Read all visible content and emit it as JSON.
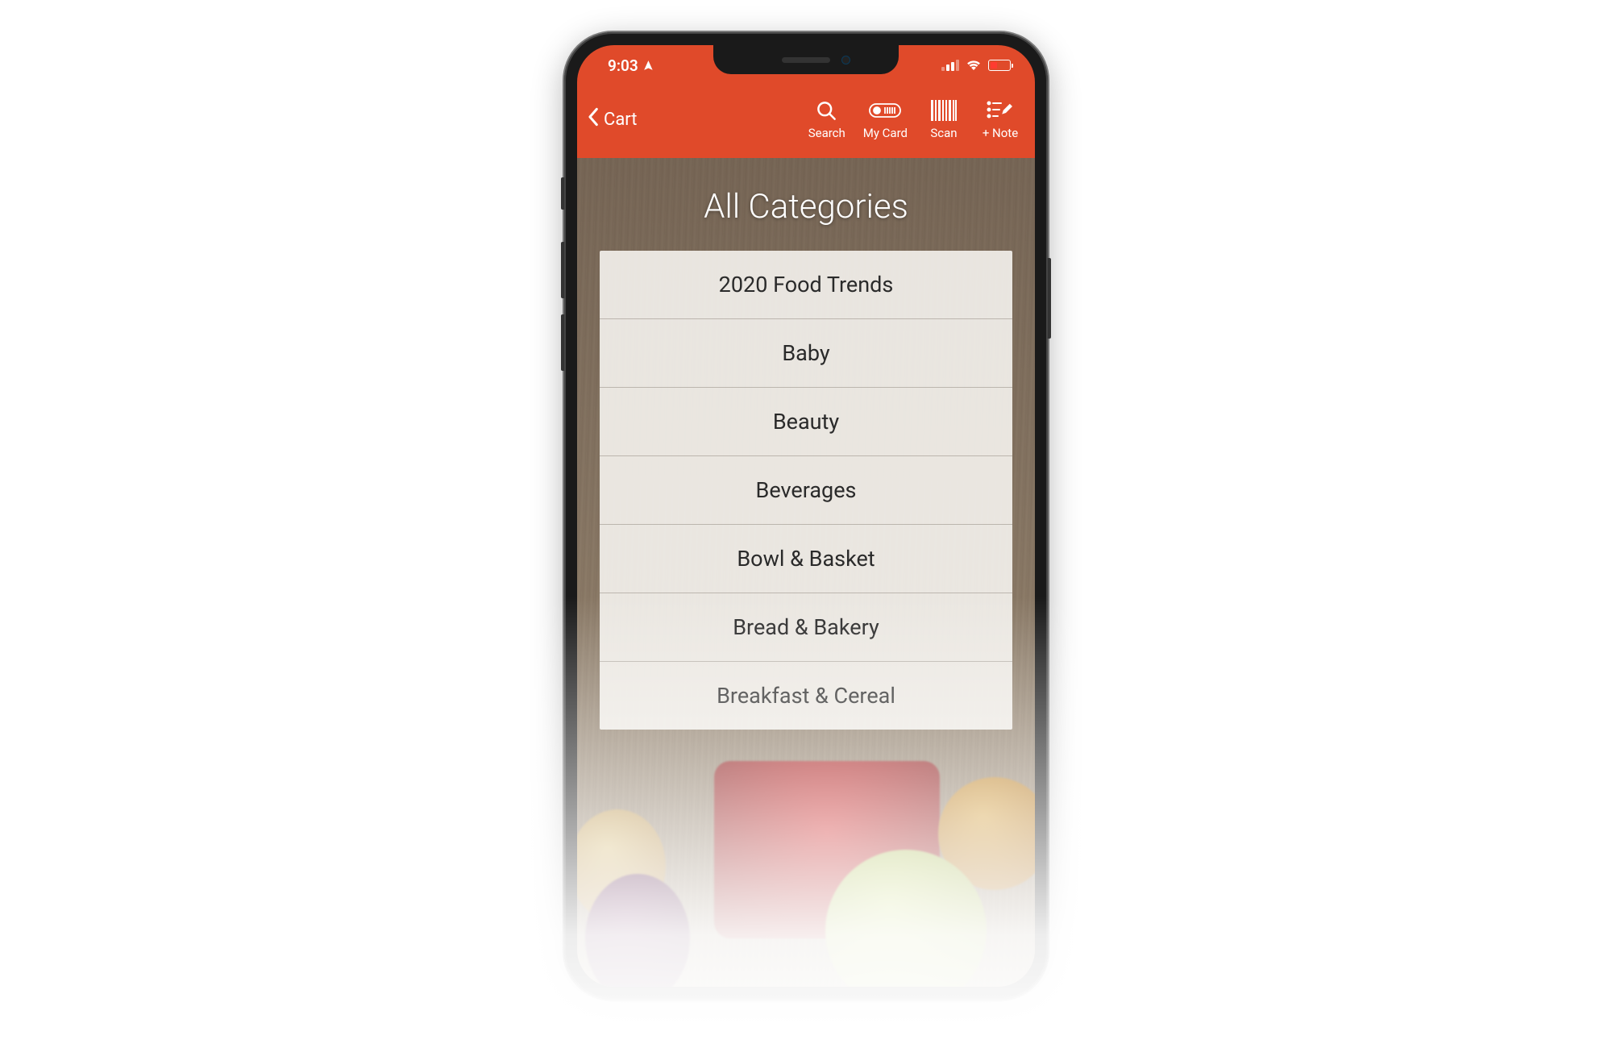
{
  "status_bar": {
    "time": "9:03"
  },
  "nav": {
    "back_label": "Cart",
    "actions": {
      "search": "Search",
      "my_card": "My Card",
      "scan": "Scan",
      "note": "+ Note"
    }
  },
  "page": {
    "title": "All Categories"
  },
  "categories": [
    "2020 Food Trends",
    "Baby",
    "Beauty",
    "Beverages",
    "Bowl & Basket",
    "Bread & Bakery",
    "Breakfast & Cereal"
  ],
  "colors": {
    "accent": "#e04a2a"
  }
}
